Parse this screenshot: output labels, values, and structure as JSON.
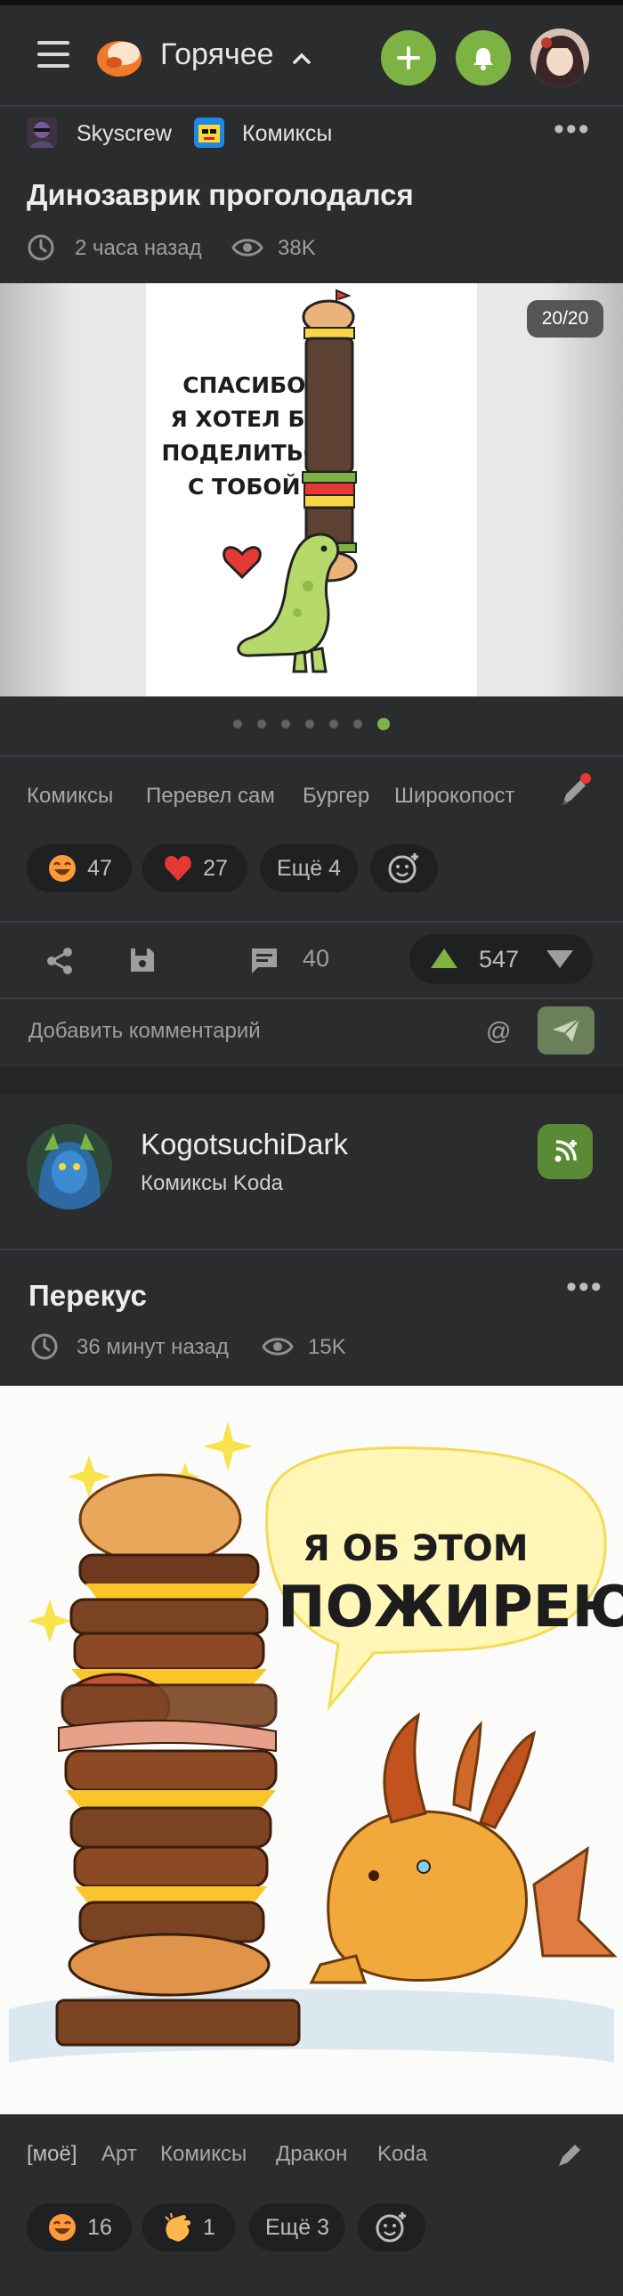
{
  "header": {
    "title": "Горячее",
    "icons": {
      "menu": "hamburger-icon",
      "add": "plus-icon",
      "notifications": "bell-icon",
      "logo": "pikabu-logo-icon"
    }
  },
  "post1": {
    "author": "Skyscrew",
    "community": "Комиксы",
    "title": "Динозаврик проголодался",
    "time": "2 часа назад",
    "views": "38K",
    "image_counter": "20/20",
    "image_text": [
      "СПАСИБО!",
      "Я ХОТЕЛ БЫ",
      "ПОДЕЛИТЬСЯ",
      "С ТОБОЙ!"
    ],
    "pager": {
      "count": 7,
      "active": 7
    },
    "tags": [
      "Комиксы",
      "Перевел сам",
      "Бургер",
      "Широкопост"
    ],
    "reactions": [
      {
        "icon": "laughing-face-icon",
        "count": "47"
      },
      {
        "icon": "heart-icon",
        "count": "27"
      }
    ],
    "more_reactions": "Ещё 4",
    "comments": "40",
    "rating": "547",
    "comment_placeholder": "Добавить комментарий"
  },
  "post2": {
    "author": "KogotsuchiDark",
    "community": "Комиксы Koda",
    "title": "Перекус",
    "time": "36 минут назад",
    "views": "15K",
    "image_text_line1": "Я ОБ ЭТОМ",
    "image_text_line2": "ПОЖИРЕЮ...",
    "tags": [
      "[моё]",
      "Арт",
      "Комиксы",
      "Дракон",
      "Koda"
    ],
    "reactions": [
      {
        "icon": "laughing-face-icon",
        "count": "16"
      },
      {
        "icon": "clapping-hands-icon",
        "count": "1"
      }
    ],
    "more_reactions": "Ещё 3"
  },
  "colors": {
    "accent": "#7cb342",
    "background": "#2b2c2e",
    "heart": "#e53935"
  }
}
